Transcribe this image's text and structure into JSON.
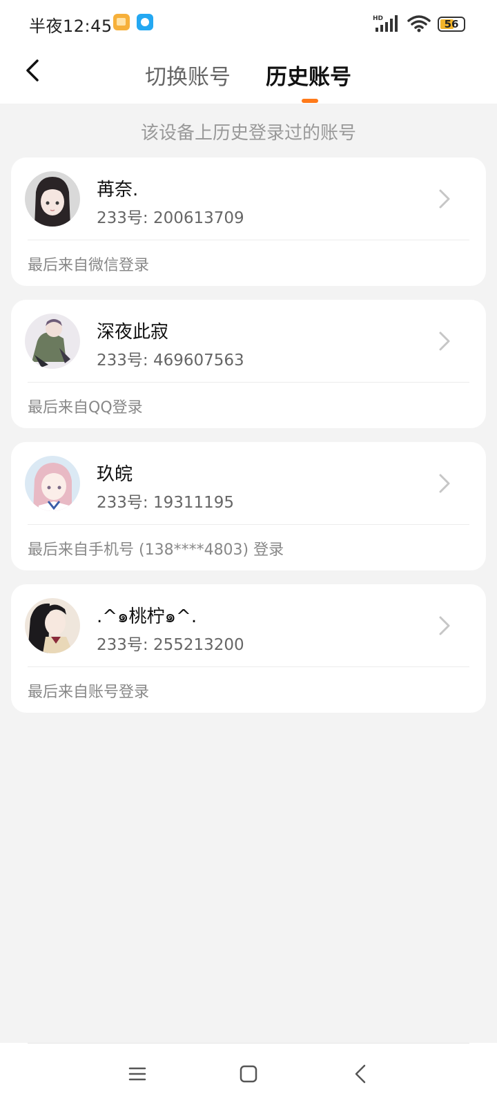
{
  "status_bar": {
    "time": "半夜12:45",
    "battery": "56",
    "network": "HD"
  },
  "header": {
    "tabs": [
      {
        "label": "切换账号",
        "active": false
      },
      {
        "label": "历史账号",
        "active": true
      }
    ],
    "accent_color": "#ff7a1a"
  },
  "subtitle": "该设备上历史登录过的账号",
  "accounts": [
    {
      "name": "苒奈.",
      "id": "233号: 200613709",
      "login_source": "最后来自微信登录"
    },
    {
      "name": "深夜此寂",
      "id": "233号: 469607563",
      "login_source": "最后来自QQ登录"
    },
    {
      "name": "玖皖",
      "id": "233号: 19311195",
      "login_source": "最后来自手机号 (138****4803) 登录"
    },
    {
      "name": ".^๑桃柠๑^.",
      "id": "233号: 255213200",
      "login_source": "最后来自账号登录"
    }
  ]
}
